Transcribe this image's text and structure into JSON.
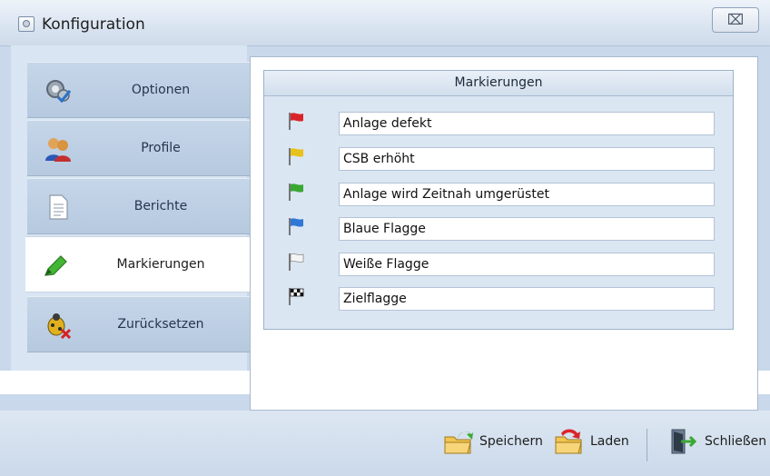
{
  "window": {
    "title": "Konfiguration",
    "close_glyph": "⌧"
  },
  "nav": {
    "items": [
      {
        "label": "Optionen",
        "icon": "settings-gear-icon",
        "active": false
      },
      {
        "label": "Profile",
        "icon": "users-icon",
        "active": false
      },
      {
        "label": "Berichte",
        "icon": "document-icon",
        "active": false
      },
      {
        "label": "Markierungen",
        "icon": "highlighter-icon",
        "active": true
      },
      {
        "label": "Zurücksetzen",
        "icon": "bug-reset-icon",
        "active": false
      }
    ]
  },
  "markings": {
    "title": "Markierungen",
    "rows": [
      {
        "value": "Anlage defekt",
        "flag_color": "#d9252a",
        "flag_icon": "red-flag-icon"
      },
      {
        "value": "CSB erhöht",
        "flag_color": "#e8c21a",
        "flag_icon": "yellow-flag-icon"
      },
      {
        "value": "Anlage wird Zeitnah umgerüstet",
        "flag_color": "#3aa832",
        "flag_icon": "green-flag-icon"
      },
      {
        "value": "Blaue Flagge",
        "flag_color": "#2f78d6",
        "flag_icon": "blue-flag-icon"
      },
      {
        "value": "Weiße Flagge",
        "flag_color": "#f4f4f4",
        "flag_icon": "white-flag-icon"
      },
      {
        "value": "Zielflagge",
        "flag_color": "#000000",
        "flag_icon": "checkered-flag-icon"
      }
    ]
  },
  "footer": {
    "save_label": "Speichern",
    "load_label": "Laden",
    "close_label": "Schließen"
  }
}
